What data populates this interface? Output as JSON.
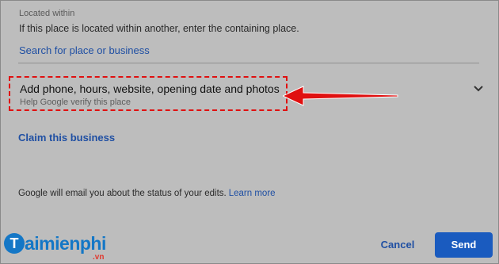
{
  "located_within": {
    "label": "Located within",
    "help": "If this place is located within another, enter the containing place.",
    "search_placeholder": "Search for place or business"
  },
  "add_details": {
    "title": "Add phone, hours, website, opening date and photos",
    "subtitle": "Help Google verify this place",
    "expand_icon": "chevron-down-icon"
  },
  "claim": {
    "label": "Claim this business"
  },
  "notice": {
    "text": "Google will email you about the status of your edits.",
    "link": "Learn more"
  },
  "watermark": {
    "name": "Taimienphi",
    "tld": ".vn"
  },
  "actions": {
    "cancel": "Cancel",
    "send": "Send"
  },
  "colors": {
    "accent": "#1a5bbf",
    "highlight": "#e01010"
  }
}
